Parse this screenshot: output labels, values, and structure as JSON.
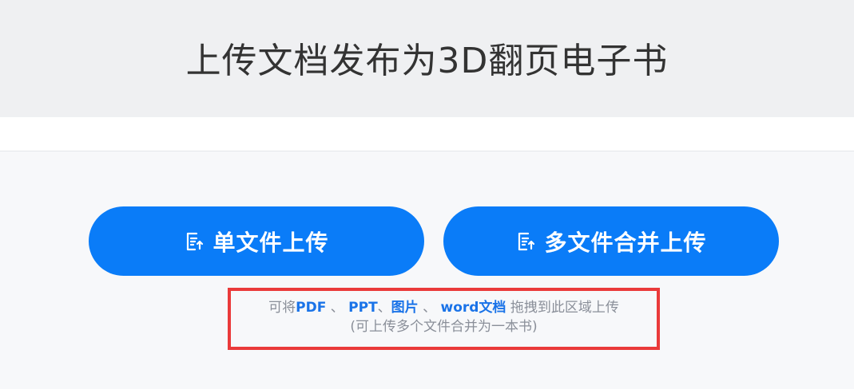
{
  "header": {
    "title": "上传文档发布为3D翻页电子书"
  },
  "buttons": {
    "single": {
      "label": "单文件上传",
      "icon": "file-upload-icon"
    },
    "multi": {
      "label": "多文件合并上传",
      "icon": "file-upload-icon"
    }
  },
  "hint": {
    "prefix": "可将",
    "formats": [
      "PDF",
      "PPT",
      "图片",
      "word文档"
    ],
    "sep1": " 、",
    "sep2": "、",
    "sep3": " 、",
    "suffix": " 拖拽到此区域上传",
    "line2": "(可上传多个文件合并为一本书)"
  },
  "colors": {
    "accent": "#0a7cf8",
    "format_text": "#1a73e8",
    "highlight_border": "#ea3a3a",
    "header_bg": "#eff0f2"
  }
}
